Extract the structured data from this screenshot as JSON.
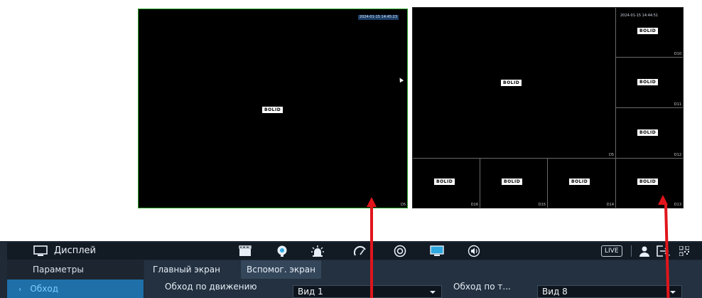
{
  "left_screen": {
    "timestamp": "2024-01-15 14:45:23",
    "logo": "BOLID",
    "channel": "D5"
  },
  "right_screen": {
    "timestamp": "2024-01-15 14:44:51",
    "logo": "BOLID",
    "cells": [
      {
        "channel": "D5",
        "logo": "BOLID"
      },
      {
        "channel": "D10",
        "logo": "BOLID"
      },
      {
        "channel": "D11",
        "logo": "BOLID"
      },
      {
        "channel": "D12",
        "logo": "BOLID"
      },
      {
        "channel": "D16",
        "logo": "BOLID"
      },
      {
        "channel": "D15",
        "logo": "BOLID"
      },
      {
        "channel": "D14",
        "logo": "BOLID"
      },
      {
        "channel": "D13",
        "logo": "BOLID"
      }
    ]
  },
  "topbar": {
    "title": "Дисплей",
    "live_label": "LIVE"
  },
  "sidebar": {
    "items": [
      {
        "label": "Параметры"
      },
      {
        "label": "Обход"
      }
    ]
  },
  "tabs": [
    {
      "label": "Главный экран"
    },
    {
      "label": "Вспомог. экран"
    }
  ],
  "fields": {
    "motion_tour_label": "Обход по движению",
    "motion_tour_value": "Вид 1",
    "alarm_tour_label": "Обход по т...",
    "alarm_tour_value": "Вид 8"
  },
  "colors": {
    "accent": "#2fa8e0",
    "arrow": "#e0151b",
    "menu_bg": "#1f2a36",
    "active_border": "#2fa82f"
  }
}
